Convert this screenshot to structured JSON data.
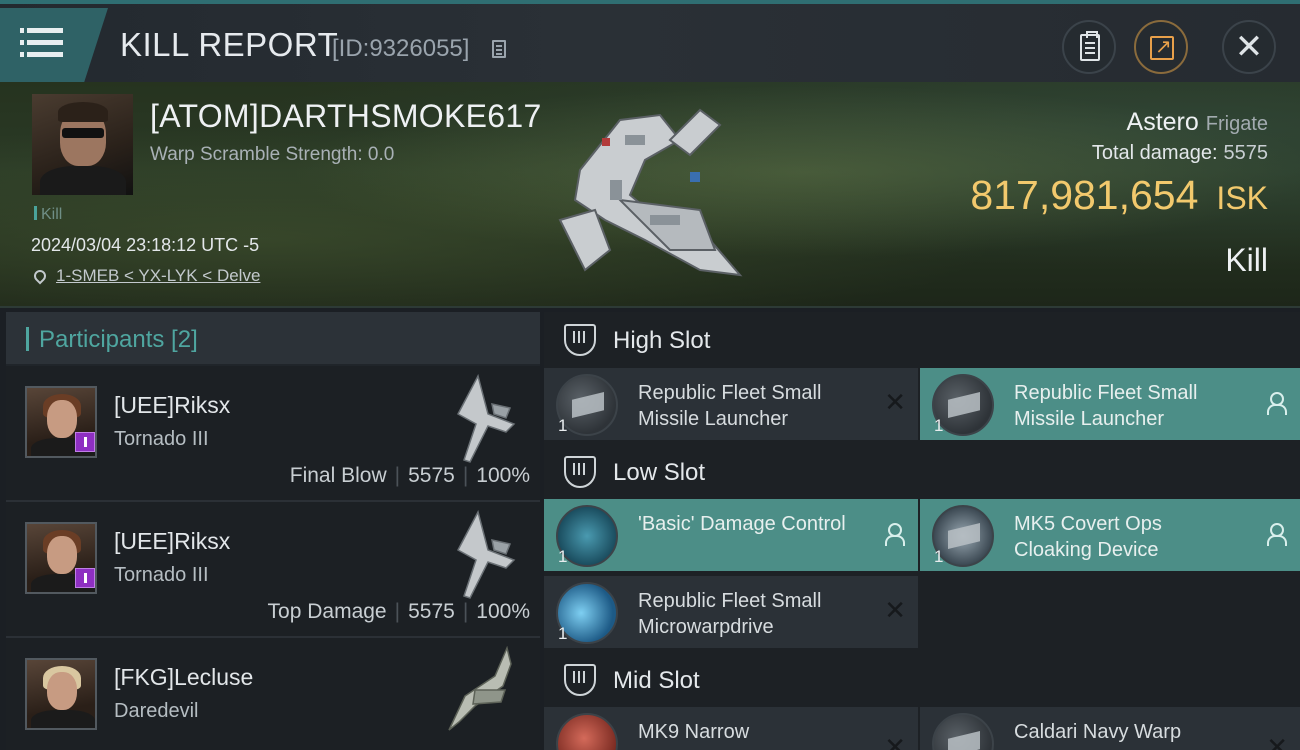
{
  "header": {
    "title": "KILL REPORT",
    "report_id": "[ID:9326055]",
    "buttons": [
      "clipboard-icon",
      "share-icon",
      "close-icon"
    ]
  },
  "victim": {
    "pilot": "[ATOM]DARTHSMOKE617",
    "warp_scramble": "Warp Scramble Strength: 0.0",
    "kill_tag": "Kill",
    "datetime": "2024/03/04 23:18:12 UTC -5",
    "location": "1-SMEB < YX-LYK < Delve",
    "ship_name": "Astero",
    "ship_class": "Frigate",
    "total_damage_label": "Total damage:",
    "total_damage": "5575",
    "isk_value": "817,981,654",
    "isk_unit": "ISK",
    "result": "Kill"
  },
  "participants": {
    "title": "Participants [2]",
    "rows": [
      {
        "name": "[UEE]Riksx",
        "ship": "Tornado III",
        "role": "Final Blow",
        "damage": "5575",
        "percent": "100%"
      },
      {
        "name": "[UEE]Riksx",
        "ship": "Tornado III",
        "role": "Top Damage",
        "damage": "5575",
        "percent": "100%"
      },
      {
        "name": "[FKG]Lecluse",
        "ship": "Daredevil"
      }
    ]
  },
  "fitting": {
    "high_slot": {
      "label": "High Slot",
      "items": [
        {
          "qty": "1",
          "name": "Republic Fleet Small Missile Launcher",
          "state": "destroyed"
        },
        {
          "qty": "1",
          "name": "Republic Fleet Small Missile Launcher",
          "state": "dropped"
        }
      ]
    },
    "low_slot": {
      "label": "Low Slot",
      "items": [
        {
          "qty": "1",
          "name": "'Basic' Damage Control",
          "state": "dropped"
        },
        {
          "qty": "1",
          "name": "MK5 Covert Ops Cloaking Device",
          "state": "dropped"
        },
        {
          "qty": "1",
          "name": "Republic Fleet Small Microwarpdrive",
          "state": "destroyed"
        }
      ]
    },
    "mid_slot": {
      "label": "Mid Slot",
      "items": [
        {
          "name": "MK9 Narrow"
        },
        {
          "name": "Caldari Navy Warp"
        }
      ]
    }
  },
  "colors": {
    "accent_teal": "#4fa6a0",
    "dropped_item_bg": "#4c8e87",
    "isk_gold": "#f2c96d"
  }
}
